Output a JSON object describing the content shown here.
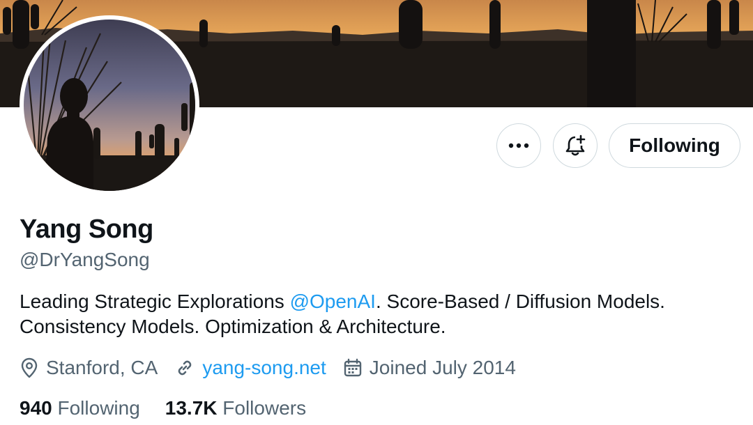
{
  "profile": {
    "name": "Yang Song",
    "handle": "@DrYangSong",
    "bio_before": "Leading Strategic Explorations ",
    "bio_mention": "@OpenAI",
    "bio_after": ". Score-Based / Diffusion Models. Consistency Models. Optimization & Architecture.",
    "location": "Stanford, CA",
    "website": "yang-song.net",
    "joined": "Joined July 2014"
  },
  "stats": {
    "following_count": "940",
    "following_label": "Following",
    "followers_count": "13.7K",
    "followers_label": "Followers"
  },
  "actions": {
    "more_label": "More",
    "notify_label": "Notifications",
    "follow_label": "Following"
  },
  "icons": {
    "more": "more-dots-icon",
    "notify": "bell-plus-icon",
    "location": "location-pin-icon",
    "website": "link-icon",
    "joined": "calendar-icon"
  },
  "colors": {
    "text": "#0f1419",
    "secondary": "#536471",
    "accent": "#1d9bf0",
    "border": "#cfd9de"
  }
}
